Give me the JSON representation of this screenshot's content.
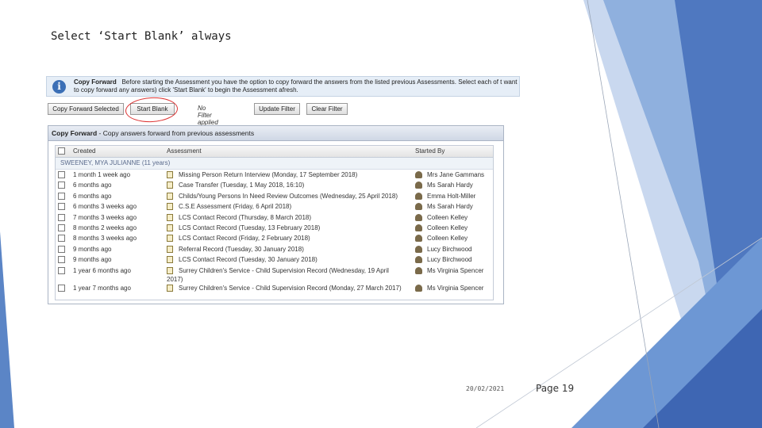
{
  "slide": {
    "title": "Select ‘Start Blank’ always",
    "date": "20/02/2021",
    "page": "Page 19"
  },
  "info": {
    "heading": "Copy Forward",
    "text": "Before starting the Assessment you have the option to copy forward the answers from the listed previous Assessments. Select each of t want to copy forward any answers) click 'Start Blank' to begin the Assessment afresh."
  },
  "toolbar": {
    "copy_selected": "Copy Forward Selected",
    "start_blank": "Start Blank",
    "filter_status": "No Filter applied",
    "update_filter": "Update Filter",
    "clear_filter": "Clear Filter"
  },
  "panel": {
    "title": "Copy Forward",
    "subtitle": "- Copy answers forward from previous assessments",
    "columns": [
      "Created",
      "Assessment",
      "Started By"
    ],
    "group": "SWEENEY, MYA JULIANNE (11 years)",
    "rows": [
      {
        "created": "1 month 1 week ago",
        "assessment": "Missing Person Return Interview (Monday, 17 September 2018)",
        "started_by": "Mrs Jane Gammans"
      },
      {
        "created": "6 months ago",
        "assessment": "Case Transfer (Tuesday, 1 May 2018, 16:10)",
        "started_by": "Ms Sarah Hardy"
      },
      {
        "created": "6 months ago",
        "assessment": "Childs/Young Persons In Need Review Outcomes (Wednesday, 25 April 2018)",
        "started_by": "Emma Holt-Miller"
      },
      {
        "created": "6 months 3 weeks ago",
        "assessment": "C.S.E Assessment (Friday, 6 April 2018)",
        "started_by": "Ms Sarah Hardy"
      },
      {
        "created": "7 months 3 weeks ago",
        "assessment": "LCS Contact Record (Thursday, 8 March 2018)",
        "started_by": "Colleen Kelley"
      },
      {
        "created": "8 months 2 weeks ago",
        "assessment": "LCS Contact Record (Tuesday, 13 February 2018)",
        "started_by": "Colleen Kelley"
      },
      {
        "created": "8 months 3 weeks ago",
        "assessment": "LCS Contact Record (Friday, 2 February 2018)",
        "started_by": "Colleen Kelley"
      },
      {
        "created": "9 months ago",
        "assessment": "Referral Record (Tuesday, 30 January 2018)",
        "started_by": "Lucy Birchwood"
      },
      {
        "created": "9 months ago",
        "assessment": "LCS Contact Record (Tuesday, 30 January 2018)",
        "started_by": "Lucy Birchwood"
      },
      {
        "created": "1 year 6 months ago",
        "assessment": "Surrey Children's Service - Child Supervision Record (Wednesday, 19 April 2017)",
        "started_by": "Ms Virginia Spencer"
      },
      {
        "created": "1 year 7 months ago",
        "assessment": "Surrey Children's Service - Child Supervision Record (Monday, 27 March 2017)",
        "started_by": "Ms Virginia Spencer"
      }
    ]
  },
  "colors": {
    "accent_blue": "#4a78c2",
    "light_blue": "#9cb8e0",
    "annotation_red": "#d33333"
  }
}
